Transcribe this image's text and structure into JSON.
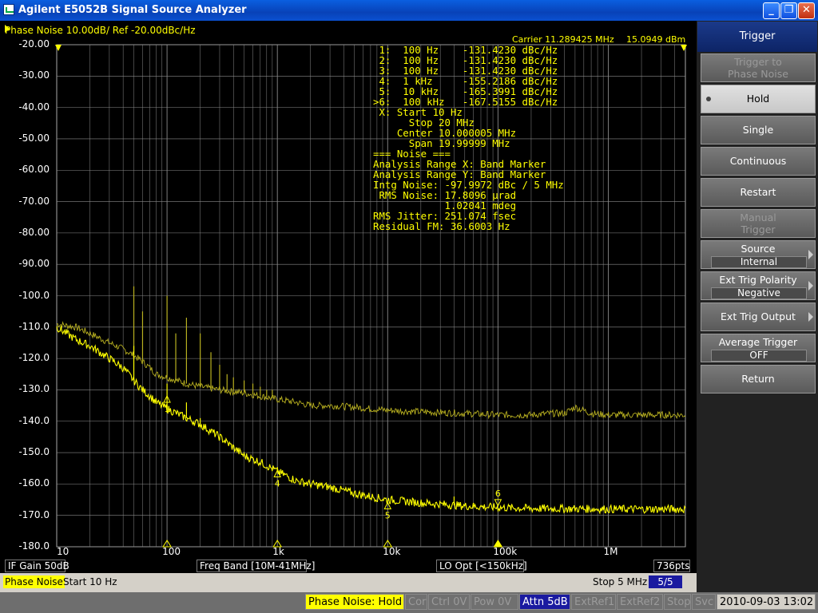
{
  "window": {
    "title": "Agilent E5052B Signal Source Analyzer",
    "minimize_glyph": "_",
    "restore_glyph": "❐",
    "close_glyph": "✕"
  },
  "trace": {
    "header": "Phase Noise 10.00dB/ Ref -20.00dBc/Hz",
    "carrier": "Carrier 11.289425 MHz",
    "carrier_power": "15.0949 dBm"
  },
  "marker_readout": [
    " 1:  100 Hz    -131.4230 dBc/Hz",
    " 2:  100 Hz    -131.4230 dBc/Hz",
    " 3:  100 Hz    -131.4230 dBc/Hz",
    " 4:  1 kHz     -155.2186 dBc/Hz",
    " 5:  10 kHz    -165.3991 dBc/Hz",
    ">6:  100 kHz   -167.5155 dBc/Hz",
    " X: Start 10 Hz",
    "      Stop 20 MHz",
    "    Center 10.000005 MHz",
    "      Span 19.99999 MHz",
    "=== Noise ===",
    "Analysis Range X: Band Marker",
    "Analysis Range Y: Band Marker",
    "Intg Noise: -97.9972 dBc / 5 MHz",
    " RMS Noise: 17.8096 µrad",
    "            1.02041 mdeg",
    "RMS Jitter: 251.074 fsec",
    "Residual FM: 36.6003 Hz"
  ],
  "status_row1": {
    "if_gain": "IF Gain 50dB",
    "freq_band": "Freq Band [10M-41MHz]",
    "lo_opt": "LO Opt [<150kHz]",
    "points": "736pts"
  },
  "status_row2": {
    "meas": "Phase Noise",
    "start": "Start 10 Hz",
    "stop": "Stop 5 MHz",
    "trace_count": "5/5"
  },
  "bottom_bar": {
    "phase_noise_state": "Phase Noise: Hold",
    "cor": "Cor",
    "ctrl": "Ctrl  0V",
    "pow": "Pow  0V",
    "attn": "Attn 5dB",
    "extref1": "ExtRef1",
    "extref2": "ExtRef2",
    "stop": "Stop",
    "svc": "Svc",
    "datetime": "2010-09-03  13:02"
  },
  "softkeys": {
    "title": "Trigger",
    "trigger_to_phase_noise": [
      "Trigger to",
      "Phase Noise"
    ],
    "hold": "Hold",
    "single": "Single",
    "continuous": "Continuous",
    "restart": "Restart",
    "manual_trigger": [
      "Manual",
      "Trigger"
    ],
    "source_label": "Source",
    "source_value": "Internal",
    "polarity_label": "Ext Trig Polarity",
    "polarity_value": "Negative",
    "ext_trig_output": "Ext Trig Output",
    "avg_trigger_label": "Average Trigger",
    "avg_trigger_value": "OFF",
    "return": "Return"
  },
  "colors": {
    "trace_active": "#ffff00",
    "trace_memory": "#b8b020",
    "grid": "#8a8a8a",
    "background": "#000000",
    "softkey_title": "#0d2466"
  },
  "chart_data": {
    "type": "line",
    "x_scale": "log",
    "y_scale": "linear",
    "xlim": [
      10,
      5000000
    ],
    "ylim": [
      -180,
      -20
    ],
    "y_ticks": [
      "-20.00",
      "-30.00",
      "-40.00",
      "-50.00",
      "-60.00",
      "-70.00",
      "-80.00",
      "-90.00",
      "-100.0",
      "-110.0",
      "-120.0",
      "-130.0",
      "-140.0",
      "-150.0",
      "-160.0",
      "-170.0",
      "-180.0"
    ],
    "x_ticks": [
      "10",
      "100",
      "1k",
      "10k",
      "100k",
      "1M"
    ],
    "grid": true,
    "series": [
      {
        "x": [
          10,
          15,
          20,
          30,
          40,
          50,
          60,
          70,
          80,
          100,
          150,
          200,
          300,
          500,
          700,
          1000,
          1500,
          2000,
          3000,
          5000,
          7000,
          10000,
          20000,
          50000,
          100000,
          200000,
          500000,
          1000000,
          2000000,
          5000000
        ],
        "y": [
          -110,
          -114,
          -116,
          -120,
          -123,
          -127,
          -130,
          -132,
          -134,
          -136,
          -139,
          -141,
          -145,
          -151,
          -153,
          -156,
          -159,
          -160,
          -161,
          -163,
          -164,
          -165,
          -166,
          -167,
          -167.5,
          -167.8,
          -167.9,
          -168,
          -168,
          -168
        ]
      },
      {
        "x": [
          10,
          15,
          20,
          30,
          40,
          50,
          60,
          70,
          80,
          100,
          150,
          200,
          300,
          500,
          700,
          1000,
          1500,
          2000,
          3000,
          5000,
          7000,
          10000,
          20000,
          50000,
          100000,
          200000,
          300000,
          400000,
          500000,
          700000,
          1000000,
          2000000,
          5000000
        ],
        "y": [
          -109,
          -110,
          -112,
          -115,
          -117,
          -119,
          -121,
          -123,
          -125,
          -126,
          -128,
          -129,
          -130,
          -131,
          -132,
          -133,
          -134,
          -135,
          -135,
          -135.5,
          -136,
          -136.5,
          -137,
          -137.5,
          -138,
          -138,
          -137.5,
          -137.5,
          -135.5,
          -137.5,
          -138,
          -138,
          -138
        ]
      }
    ],
    "spurs": [
      {
        "x": 50,
        "y": -97
      },
      {
        "x": 60,
        "y": -105
      },
      {
        "x": 100,
        "y": -100
      },
      {
        "x": 120,
        "y": -112
      },
      {
        "x": 150,
        "y": -107
      },
      {
        "x": 200,
        "y": -112
      },
      {
        "x": 250,
        "y": -118
      },
      {
        "x": 300,
        "y": -122
      },
      {
        "x": 350,
        "y": -125
      },
      {
        "x": 400,
        "y": -126
      },
      {
        "x": 500,
        "y": -127
      },
      {
        "x": 600,
        "y": -128
      },
      {
        "x": 700,
        "y": -129
      },
      {
        "x": 800,
        "y": -130
      },
      {
        "x": 900,
        "y": -130
      }
    ],
    "low_spurs": [
      {
        "x": 50,
        "y": -116
      },
      {
        "x": 100,
        "y": -128
      },
      {
        "x": 150,
        "y": -134
      },
      {
        "x": 200,
        "y": -139
      },
      {
        "x": 300,
        "y": -146
      },
      {
        "x": 600,
        "y": -152
      },
      {
        "x": 700,
        "y": -153
      },
      {
        "x": 1000,
        "y": -155
      },
      {
        "x": 40000,
        "y": -164
      },
      {
        "x": 60000,
        "y": -166
      }
    ],
    "markers": [
      {
        "label": "1",
        "x": 100,
        "y": -131.4
      },
      {
        "label": "4",
        "x": 1000,
        "y": -155.2
      },
      {
        "label": "5",
        "x": 10000,
        "y": -165.4
      },
      {
        "label": "6",
        "x": 100000,
        "y": -167.5
      }
    ]
  }
}
